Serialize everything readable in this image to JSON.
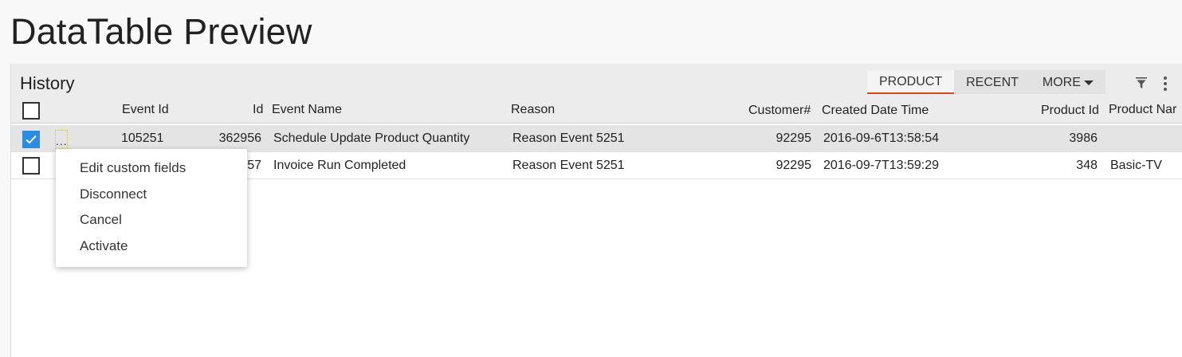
{
  "page": {
    "title": "DataTable Preview"
  },
  "panel": {
    "title": "History",
    "tabs": [
      {
        "label": "PRODUCT",
        "active": true
      },
      {
        "label": "RECENT",
        "active": false
      },
      {
        "label": "MORE",
        "active": false
      }
    ],
    "filter_icon": "filter-icon",
    "more_icon": "vertical-ellipsis-icon"
  },
  "table": {
    "columns": {
      "event_id": "Event Id",
      "id": "Id",
      "event_name": "Event Name",
      "reason": "Reason",
      "customer": "Customer#",
      "created": "Created Date Time",
      "product_id": "Product Id",
      "product_name": "Product Nar"
    },
    "rows": [
      {
        "checked": true,
        "menu_trigger": "...",
        "event_id": "105251",
        "id": "362956",
        "event_name": "Schedule Update Product Quantity",
        "reason": "Reason Event 5251",
        "customer": "92295",
        "created": "2016-09-6T13:58:54",
        "product_id": "3986",
        "product_name": ""
      },
      {
        "checked": false,
        "event_id": "",
        "id": "57",
        "event_name": "Invoice Run Completed",
        "reason": "Reason Event 5251",
        "customer": "92295",
        "created": "2016-09-7T13:59:29",
        "product_id": "348",
        "product_name": "Basic-TV"
      }
    ]
  },
  "context_menu": {
    "items": [
      "Edit custom fields",
      "Disconnect",
      "Cancel",
      "Activate"
    ]
  },
  "colors": {
    "checkbox_checked": "#2b8ce0",
    "tab_active_underline": "#d44a1f",
    "selected_row_bg": "#e4e4e4"
  }
}
